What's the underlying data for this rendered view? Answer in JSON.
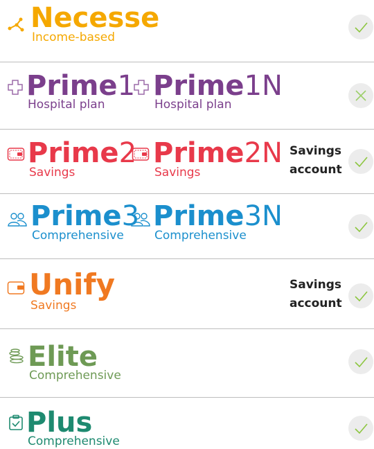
{
  "plans": [
    {
      "id": "necesse",
      "title_bold": "Necesse",
      "title_suffix": "",
      "subtitle": "Income-based",
      "color": "#f5a800",
      "icon": "network-icon",
      "second": null,
      "side_text": null,
      "status": "check"
    },
    {
      "id": "prime1",
      "title_bold": "Prime",
      "title_suffix": "1",
      "subtitle": "Hospital plan",
      "color": "#7b3f8c",
      "icon": "medical-cross-icon",
      "second": {
        "title_bold": "Prime",
        "title_suffix": "1N",
        "subtitle": "Hospital plan"
      },
      "side_text": null,
      "status": "cross"
    },
    {
      "id": "prime2",
      "title_bold": "Prime",
      "title_suffix": "2",
      "subtitle": "Savings",
      "color": "#e8394a",
      "icon": "wallet-icon",
      "second": {
        "title_bold": "Prime",
        "title_suffix": "2N",
        "subtitle": "Savings"
      },
      "side_text": [
        "Savings",
        "account"
      ],
      "status": "check"
    },
    {
      "id": "prime3",
      "title_bold": "Prime",
      "title_suffix": "3",
      "subtitle": "Comprehensive",
      "color": "#1b8fcd",
      "icon": "people-icon",
      "second": {
        "title_bold": "Prime",
        "title_suffix": "3N",
        "subtitle": "Comprehensive"
      },
      "side_text": null,
      "status": "check"
    },
    {
      "id": "unify",
      "title_bold": "Unify",
      "title_suffix": "",
      "subtitle": "Savings",
      "color": "#f07921",
      "icon": "wallet-icon",
      "second": null,
      "side_text": [
        "Savings",
        "account"
      ],
      "status": "check"
    },
    {
      "id": "elite",
      "title_bold": "Elite",
      "title_suffix": "",
      "subtitle": "Comprehensive",
      "color": "#6e9a55",
      "icon": "coins-icon",
      "second": null,
      "side_text": null,
      "status": "check"
    },
    {
      "id": "plus",
      "title_bold": "Plus",
      "title_suffix": "",
      "subtitle": "Comprehensive",
      "color": "#1e8a70",
      "icon": "clipboard-check-icon",
      "second": null,
      "side_text": null,
      "status": "check"
    }
  ],
  "colors": {
    "divider": "#bdbdbd",
    "status_bg": "#ececec",
    "check": "#8cc63f",
    "cross": "#9dcf6a"
  }
}
